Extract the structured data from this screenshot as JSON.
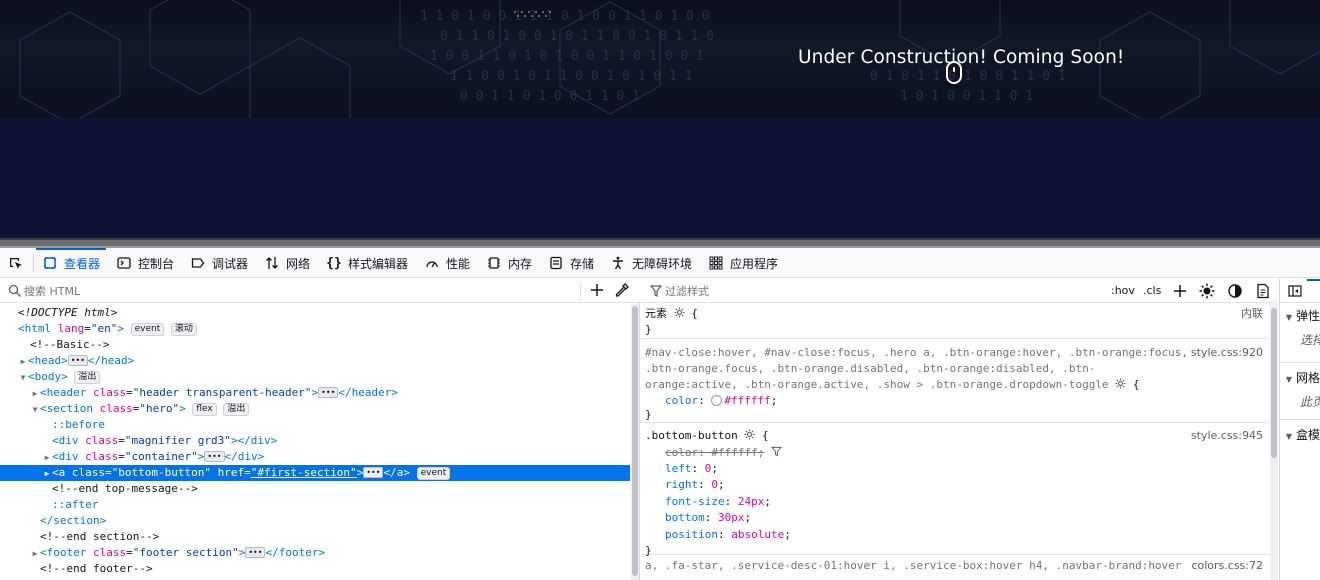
{
  "page": {
    "hero_message": "Under Construction! Coming Soon!"
  },
  "devtools": {
    "tabs": [
      {
        "label": "查看器",
        "icon": "inspector-icon"
      },
      {
        "label": "控制台",
        "icon": "console-icon"
      },
      {
        "label": "调试器",
        "icon": "debugger-icon"
      },
      {
        "label": "网络",
        "icon": "network-icon"
      },
      {
        "label": "样式编辑器",
        "icon": "style-editor-icon"
      },
      {
        "label": "性能",
        "icon": "performance-icon"
      },
      {
        "label": "内存",
        "icon": "memory-icon"
      },
      {
        "label": "存储",
        "icon": "storage-icon"
      },
      {
        "label": "无障碍环境",
        "icon": "accessibility-icon"
      },
      {
        "label": "应用程序",
        "icon": "application-icon"
      }
    ],
    "html_search": {
      "placeholder": "搜索 HTML"
    },
    "styles_filter": {
      "placeholder": "过滤样式",
      "hov": ":hov",
      "cls": ".cls"
    },
    "badges": {
      "event": "event",
      "scroll": "滚动",
      "overflow": "溢出",
      "flex": "flex"
    },
    "tree": {
      "doctype": "<!DOCTYPE html>",
      "html_open": "<html",
      "lang_attr": "lang",
      "lang_val": "\"en\"",
      "close_bracket": ">",
      "comment_basic": "<!--Basic-->",
      "head_open": "<head>",
      "head_close": "</head>",
      "body_open": "<body>",
      "header_open": "<header",
      "class_attr": "class",
      "header_class": "\"header transparent-header\"",
      "header_close": "</header>",
      "section_open": "<section",
      "section_class": "\"hero\"",
      "before": "::before",
      "div_open": "<div",
      "magnifier_class": "\"magnifier grd3\"",
      "magnifier_tail": "</div>",
      "container_class": "\"container\"",
      "div_close": "</div>",
      "a_open": "<a",
      "a_class": "\"bottom-button\"",
      "href_attr": "href",
      "href_val": "\"#first-section\"",
      "a_close": "</a>",
      "comment_end_top": "<!--end top-message-->",
      "after": "::after",
      "section_close": "</section>",
      "comment_end_section": "<!--end section-->",
      "footer_open": "<footer",
      "footer_class": "\"footer section\"",
      "footer_close": "</footer>",
      "comment_end_footer": "<!--end footer-->"
    },
    "rules": {
      "element": {
        "selector": "元素",
        "brace_open": "{",
        "brace_close": "}",
        "source": "内联"
      },
      "rule1": {
        "selector_line1": "#nav-close:hover, #nav-close:focus, .hero a, .btn-orange:hover, .btn-orange:focus,",
        "selector_line2": ".btn-orange.focus, .btn-orange.disabled, .btn-orange:disabled, .btn-",
        "selector_line3": "orange:active, .btn-orange.active, .show > .btn-orange.dropdown-toggle",
        "source": "style.css:920",
        "prop": "color",
        "value": "#ffffff"
      },
      "rule2": {
        "selector": ".bottom-button",
        "source": "style.css:945",
        "decls": [
          {
            "prop": "color",
            "value": "#ffffff",
            "overridden": true
          },
          {
            "prop": "left",
            "value": "0"
          },
          {
            "prop": "right",
            "value": "0"
          },
          {
            "prop": "font-size",
            "value": "24px"
          },
          {
            "prop": "bottom",
            "value": "30px"
          },
          {
            "prop": "position",
            "value": "absolute"
          }
        ]
      },
      "rule3": {
        "selector": "a, .fa-star, .service-desc-01:hover i, .service-box:hover h4, .navbar-brand:hover",
        "source": "colors.css:72"
      }
    },
    "side_pane": {
      "sections": [
        "弹性",
        "选择",
        "网格",
        "此页",
        "盒模"
      ]
    }
  }
}
